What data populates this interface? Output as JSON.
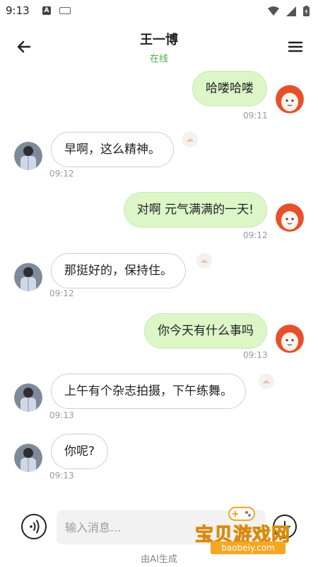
{
  "status_bar": {
    "time": "9:13",
    "a_badge": "A"
  },
  "header": {
    "name": "王一博",
    "status": "在线"
  },
  "messages": [
    {
      "side": "sent",
      "text": "哈喽哈喽",
      "time": "09:11"
    },
    {
      "side": "recv",
      "text": "早啊，这么精神。",
      "time": "09:12"
    },
    {
      "side": "sent",
      "text": "对啊 元气满满的一天!",
      "time": "09:12"
    },
    {
      "side": "recv",
      "text": "那挺好的，保持住。",
      "time": "09:12"
    },
    {
      "side": "sent",
      "text": "你今天有什么事吗",
      "time": "09:13"
    },
    {
      "side": "recv",
      "text": "上午有个杂志拍摄，下午练舞。",
      "time": "09:13"
    },
    {
      "side": "recv",
      "text": "你呢?",
      "time": "09:13"
    }
  ],
  "input": {
    "placeholder": "输入消息..."
  },
  "footer": {
    "ai_note": "由AI生成"
  },
  "watermark": {
    "title": "宝贝游戏网",
    "url": "baobeiy.com"
  },
  "colors": {
    "online": "#4caf50",
    "sent_bubble": "#dcf6c8",
    "received_bubble": "#ffffff"
  }
}
